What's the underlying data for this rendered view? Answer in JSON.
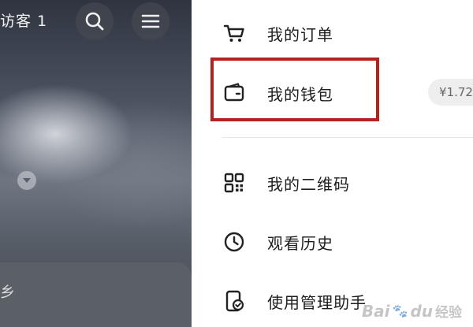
{
  "header": {
    "visitor_text": "访客 1",
    "search_icon": "search-icon",
    "menu_icon": "hamburger-menu-icon"
  },
  "profile_card": {
    "partial_text": "乡"
  },
  "menu": {
    "items": [
      {
        "label": "我的订单",
        "icon": "shopping-cart-icon"
      },
      {
        "label": "我的钱包",
        "icon": "wallet-icon",
        "badge": "¥1.72"
      },
      {
        "label": "我的二维码",
        "icon": "qr-code-icon"
      },
      {
        "label": "观看历史",
        "icon": "clock-icon"
      },
      {
        "label": "使用管理助手",
        "icon": "phone-check-icon"
      }
    ]
  },
  "annotation": {
    "highlight_color": "#b2231d"
  },
  "watermark": {
    "brand": "Bai",
    "paw": "🐾",
    "suffix": "du",
    "jingyan": "经验"
  }
}
